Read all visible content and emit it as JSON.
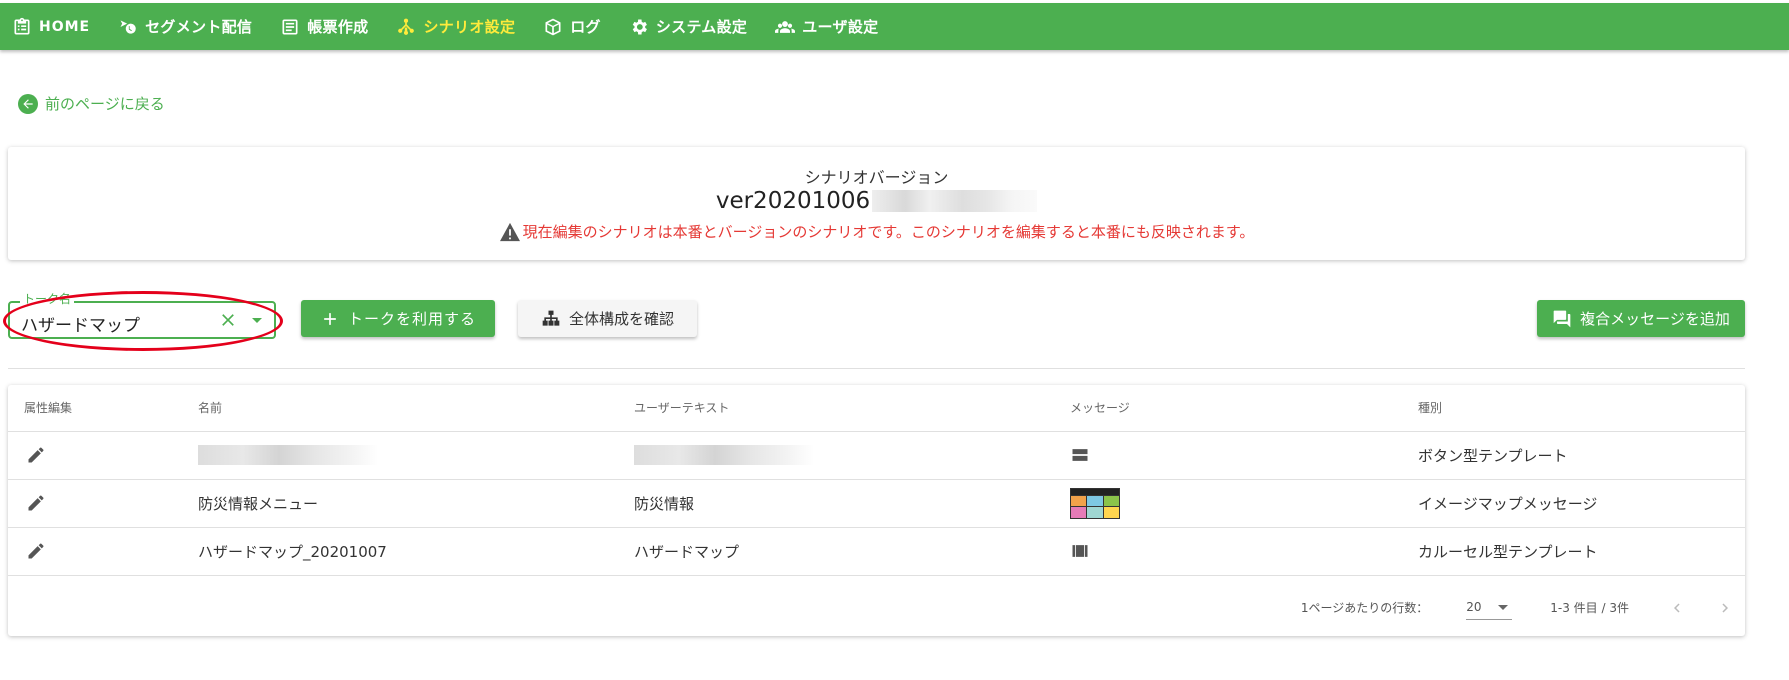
{
  "nav": {
    "items": [
      {
        "label": "HOME",
        "icon": "clipboard-icon"
      },
      {
        "label": "セグメント配信",
        "icon": "segment-send-icon"
      },
      {
        "label": "帳票作成",
        "icon": "document-icon"
      },
      {
        "label": "シナリオ設定",
        "icon": "scenario-icon",
        "active": true
      },
      {
        "label": "ログ",
        "icon": "package-icon"
      },
      {
        "label": "システム設定",
        "icon": "gear-icon"
      },
      {
        "label": "ユーザ設定",
        "icon": "users-icon"
      }
    ],
    "bg_color": "#4caf50",
    "active_color": "#ffeb3b"
  },
  "back_link": {
    "label": "前のページに戻る"
  },
  "version_card": {
    "heading": "シナリオバージョン",
    "version": "ver20201006",
    "warning": "現在編集のシナリオは本番とバージョンのシナリオです。このシナリオを編集すると本番にも反映されます。"
  },
  "talk_select": {
    "label": "トーク名",
    "value": "ハザードマップ"
  },
  "buttons": {
    "use_talk": "トークを利用する",
    "view_structure": "全体構成を確認",
    "add_compound": "複合メッセージを追加"
  },
  "table": {
    "headers": [
      "属性編集",
      "名前",
      "ユーザーテキスト",
      "メッセージ",
      "種別"
    ],
    "rows": [
      {
        "name": "",
        "user_text": "",
        "message_icon": "button-template-icon",
        "type": "ボタン型テンプレート",
        "redacted": true
      },
      {
        "name": "防災情報メニュー",
        "user_text": "防災情報",
        "message_icon": "imagemap-thumbnail",
        "type": "イメージマップメッセージ"
      },
      {
        "name": "ハザードマップ_20201007",
        "user_text": "ハザードマップ",
        "message_icon": "carousel-template-icon",
        "type": "カルーセル型テンプレート"
      }
    ]
  },
  "pager": {
    "rows_label": "1ページあたりの行数：",
    "rows_value": "20",
    "range": "1-3 件目 / 3件"
  },
  "colors": {
    "accent": "#4caf50",
    "warning": "#e53935",
    "highlight_ellipse": "#e4001b"
  }
}
